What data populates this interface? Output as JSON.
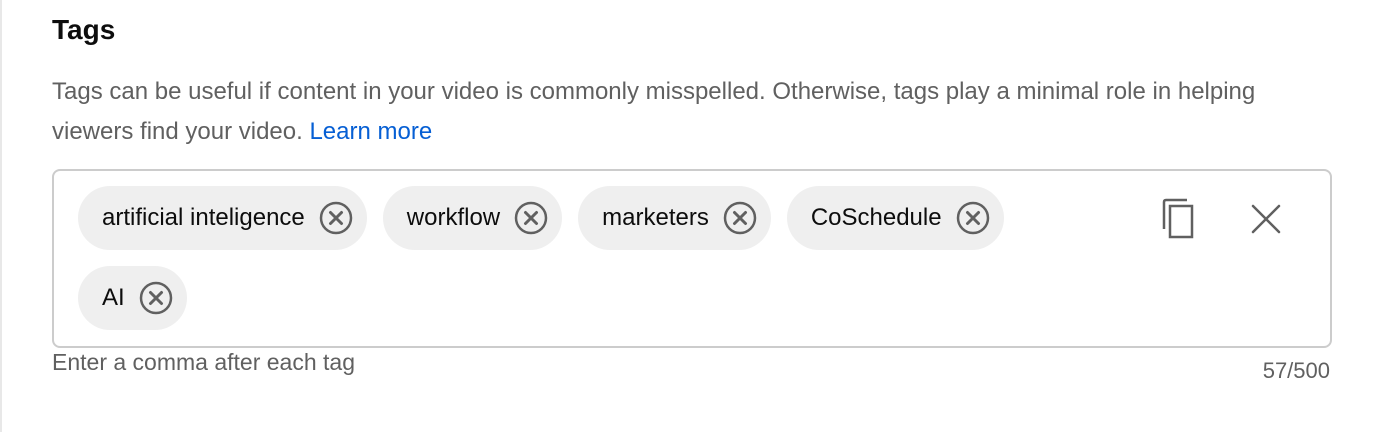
{
  "section": {
    "title": "Tags",
    "description": "Tags can be useful if content in your video is commonly misspelled. Otherwise, tags play a minimal role in helping viewers find your video.",
    "learn_more_label": "Learn more"
  },
  "tags": [
    {
      "label": "artificial inteligence",
      "remove_icon": "cancel-circle-icon"
    },
    {
      "label": "workflow",
      "remove_icon": "cancel-circle-icon"
    },
    {
      "label": "marketers",
      "remove_icon": "cancel-circle-icon"
    },
    {
      "label": "CoSchedule",
      "remove_icon": "cancel-circle-icon"
    },
    {
      "label": "AI",
      "remove_icon": "cancel-circle-icon"
    }
  ],
  "actions": {
    "copy_icon": "copy-icon",
    "clear_icon": "close-icon"
  },
  "footer": {
    "hint": "Enter a comma after each tag",
    "counter": "57/500"
  },
  "colors": {
    "text_primary": "#0d0d0d",
    "text_secondary": "#606060",
    "link": "#065fd4",
    "chip_background": "#efefef",
    "border": "#cccccc"
  }
}
